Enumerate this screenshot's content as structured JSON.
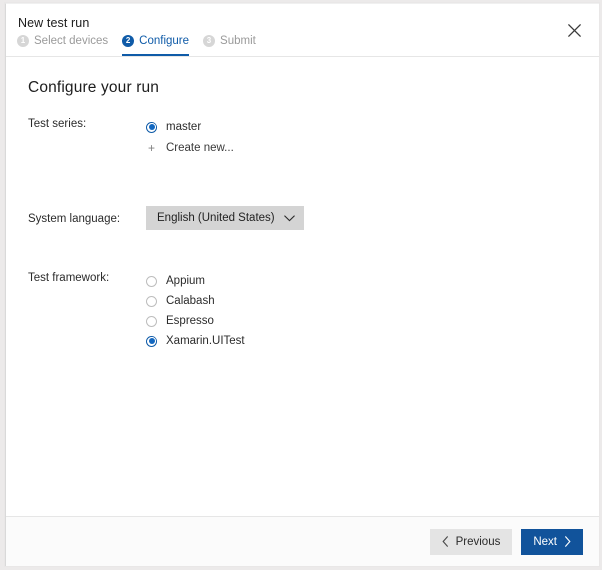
{
  "dialog": {
    "title": "New test run",
    "close_label": "Close",
    "close_icon": "close-icon"
  },
  "steps": [
    {
      "number": "1",
      "label": "Select devices",
      "active": false
    },
    {
      "number": "2",
      "label": "Configure",
      "active": true
    },
    {
      "number": "3",
      "label": "Submit",
      "active": false
    }
  ],
  "main": {
    "heading": "Configure your run",
    "test_series": {
      "label": "Test series:",
      "options": [
        {
          "label": "master",
          "selected": true
        }
      ],
      "create_new_label": "Create new...",
      "create_new_icon": "plus-icon"
    },
    "system_language": {
      "label": "System language:",
      "value": "English (United States)",
      "chevron_icon": "chevron-down-icon"
    },
    "test_framework": {
      "label": "Test framework:",
      "options": [
        {
          "label": "Appium",
          "selected": false
        },
        {
          "label": "Calabash",
          "selected": false
        },
        {
          "label": "Espresso",
          "selected": false
        },
        {
          "label": "Xamarin.UITest",
          "selected": true
        }
      ]
    }
  },
  "footer": {
    "previous_label": "Previous",
    "next_label": "Next",
    "previous_icon": "chevron-left-icon",
    "next_icon": "chevron-right-icon"
  },
  "colors": {
    "accent_blue": "#0f5ba8",
    "primary_button": "#11539b",
    "radio_selected": "#1267c0",
    "step_inactive": "#d6d6d6",
    "dropdown_bg": "#d4d4d4"
  }
}
